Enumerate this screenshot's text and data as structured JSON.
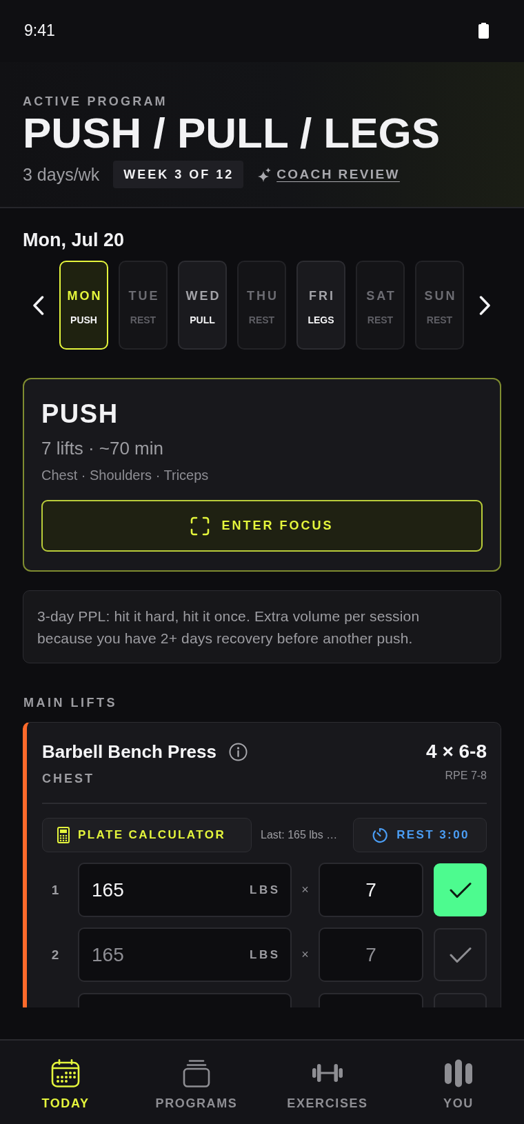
{
  "status_bar": {
    "time": "9:41"
  },
  "header": {
    "eyebrow": "ACTIVE PROGRAM",
    "title": "PUSH / PULL / LEGS",
    "frequency": "3 days/wk",
    "week_badge": "WEEK 3 OF 12",
    "coach_link": "COACH REVIEW"
  },
  "schedule": {
    "date": "Mon, Jul 20",
    "days": [
      {
        "day": "MON",
        "workout": "PUSH",
        "kind": "workout",
        "selected": true
      },
      {
        "day": "TUE",
        "workout": "REST",
        "kind": "rest",
        "selected": false
      },
      {
        "day": "WED",
        "workout": "PULL",
        "kind": "workout",
        "selected": false
      },
      {
        "day": "THU",
        "workout": "REST",
        "kind": "rest",
        "selected": false
      },
      {
        "day": "FRI",
        "workout": "LEGS",
        "kind": "workout",
        "selected": false
      },
      {
        "day": "SAT",
        "workout": "REST",
        "kind": "rest",
        "selected": false
      },
      {
        "day": "SUN",
        "workout": "REST",
        "kind": "rest",
        "selected": false
      }
    ]
  },
  "workout_card": {
    "title": "PUSH",
    "summary": "7 lifts · ~70 min",
    "muscles": "Chest · Shoulders · Triceps",
    "button": "ENTER FOCUS"
  },
  "note": "3-day PPL: hit it hard, hit it once. Extra volume per session because you have 2+ days recovery before another push.",
  "section_title": "MAIN LIFTS",
  "exercises": [
    {
      "name": "Barbell Bench Press",
      "muscle": "CHEST",
      "scheme": "4 × 6-8",
      "rpe": "RPE 7-8",
      "plate_button": "PLATE CALCULATOR",
      "last": "Last: 165 lbs …",
      "rest_button": "REST 3:00",
      "sets": [
        {
          "kind": "full",
          "number": "1",
          "weight": {
            "value": "165"
          },
          "unit": "LBS",
          "separator": "×",
          "reps": {
            "value": "7"
          },
          "done": true
        },
        {
          "kind": "full",
          "number": "2",
          "weight": {
            "placeholder": "165"
          },
          "unit": "LBS",
          "separator": "×",
          "reps": {
            "placeholder": "7"
          },
          "done": false
        },
        {
          "kind": "cut",
          "done": false
        }
      ]
    }
  ],
  "nav": [
    {
      "label": "TODAY",
      "selected": true
    },
    {
      "label": "PROGRAMS",
      "selected": false
    },
    {
      "label": "EXERCISES",
      "selected": false
    },
    {
      "label": "YOU",
      "selected": false
    }
  ]
}
